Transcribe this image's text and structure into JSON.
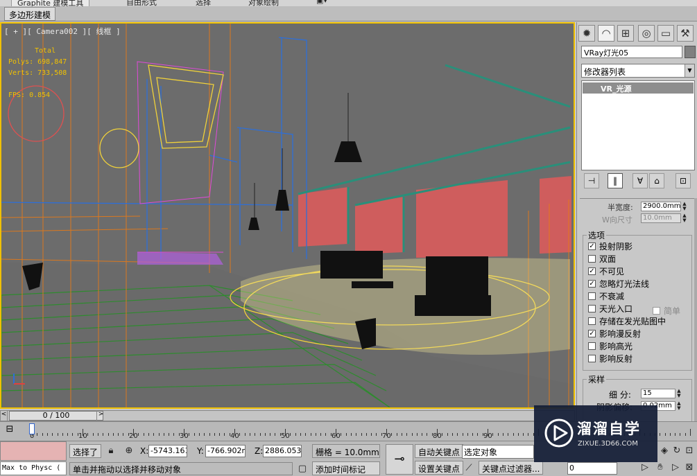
{
  "ribbon": {
    "tabs": [
      "Graphite 建模工具",
      "自由形式",
      "选择",
      "对象绘制"
    ],
    "subtab": "多边形建模"
  },
  "viewport": {
    "label": "[ + ][ Camera002 ][ 线框 ]",
    "stats": {
      "header": "Total",
      "polys": "Polys: 698,847",
      "verts": "Verts: 733,508",
      "fps": "FPS: 0.854"
    }
  },
  "command_panel": {
    "tab_icons": [
      "create-icon",
      "modify-icon",
      "hierarchy-icon",
      "motion-icon",
      "display-icon",
      "utilities-icon"
    ],
    "object_name": "VRay灯光05",
    "modifier_list": "修改器列表",
    "stack_item": "VR_光源",
    "stack_buttons": [
      "pin-stack-icon",
      "show-end-result-icon",
      "make-unique-icon",
      "remove-modifier-icon",
      "configure-sets-icon"
    ],
    "half_width_label": "半宽度:",
    "half_width_value": "2900.0mm",
    "w_size_label": "W向尺寸",
    "w_size_value": "10.0mm",
    "options_title": "选项",
    "options": [
      {
        "label": "投射阴影",
        "checked": true
      },
      {
        "label": "双面",
        "checked": false
      },
      {
        "label": "不可见",
        "checked": true
      },
      {
        "label": "忽略灯光法线",
        "checked": true
      },
      {
        "label": "不衰减",
        "checked": false
      },
      {
        "label": "天光入口",
        "checked": false
      },
      {
        "label": "存储在发光贴图中",
        "checked": false
      },
      {
        "label": "影响漫反射",
        "checked": true
      },
      {
        "label": "影响高光",
        "checked": false
      },
      {
        "label": "影响反射",
        "checked": false
      }
    ],
    "simple_label": "简单",
    "sampling_title": "采样",
    "subdivs_label": "细  分:",
    "subdivs_value": "15",
    "shadow_bias_label": "阴影偏移:",
    "shadow_bias_value": "0.02mm"
  },
  "timeline": {
    "position": "0 / 100",
    "ticks": [
      "0",
      "10",
      "20",
      "30",
      "40",
      "50",
      "60",
      "70",
      "80",
      "90"
    ]
  },
  "status": {
    "maxscript": "Max to Physc (",
    "selected": "选择了",
    "x_label": "X:",
    "x_value": "-5743.161",
    "y_label": "Y:",
    "y_value": "-766.902m",
    "z_label": "Z:",
    "z_value": "2886.053m",
    "grid": "栅格 = 10.0mm",
    "auto_key": "自动关键点",
    "selected_object": "选定对象",
    "set_key": "设置关键点",
    "key_filters": "关键点过滤器...",
    "frame_value": "0",
    "add_time_tag": "添加时间标记",
    "prompt": "单击并拖动以选择并移动对象"
  },
  "watermark": {
    "text": "溜溜自学",
    "url": "ZIXUE.3D66.COM"
  },
  "colors": {
    "viewport_bg": "#6c6c6c",
    "active_border": "#f0c000",
    "stats_text": "#f2c200",
    "wire_orange": "#e87a16",
    "wire_green": "#2e8b2e",
    "wire_blue": "#2e6fd8",
    "wire_teal": "#2a8f7a",
    "wall_red": "#e05a5a",
    "light_yellow": "#f3e89a"
  }
}
